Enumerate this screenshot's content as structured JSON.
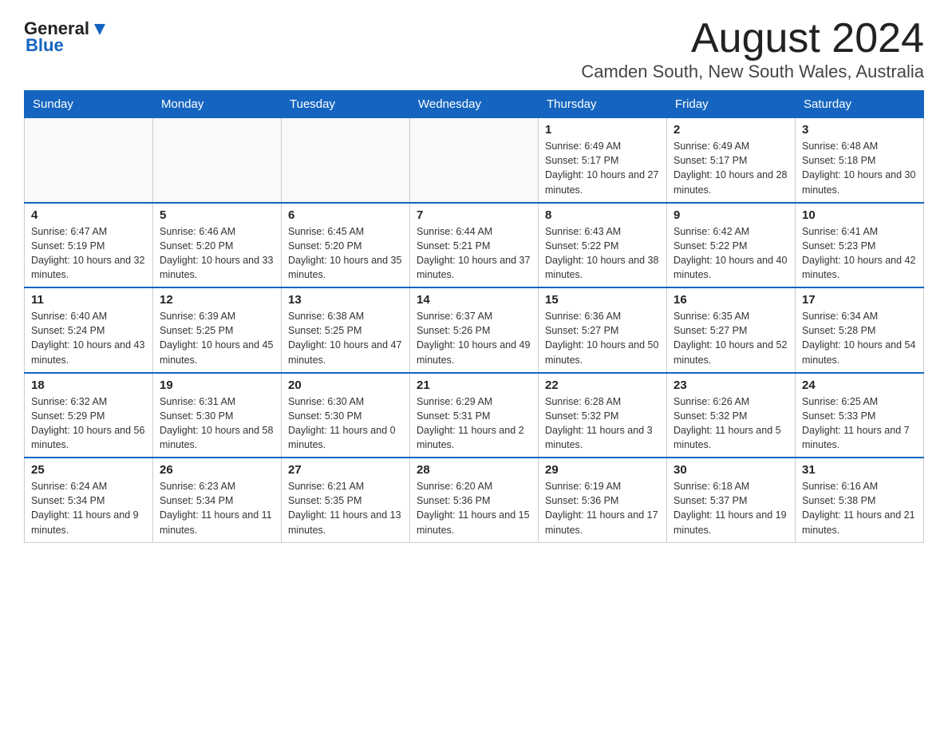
{
  "header": {
    "logo_general": "General",
    "logo_blue": "Blue",
    "month_title": "August 2024",
    "location": "Camden South, New South Wales, Australia"
  },
  "days_of_week": [
    "Sunday",
    "Monday",
    "Tuesday",
    "Wednesday",
    "Thursday",
    "Friday",
    "Saturday"
  ],
  "weeks": [
    [
      {
        "day": "",
        "info": ""
      },
      {
        "day": "",
        "info": ""
      },
      {
        "day": "",
        "info": ""
      },
      {
        "day": "",
        "info": ""
      },
      {
        "day": "1",
        "info": "Sunrise: 6:49 AM\nSunset: 5:17 PM\nDaylight: 10 hours and 27 minutes."
      },
      {
        "day": "2",
        "info": "Sunrise: 6:49 AM\nSunset: 5:17 PM\nDaylight: 10 hours and 28 minutes."
      },
      {
        "day": "3",
        "info": "Sunrise: 6:48 AM\nSunset: 5:18 PM\nDaylight: 10 hours and 30 minutes."
      }
    ],
    [
      {
        "day": "4",
        "info": "Sunrise: 6:47 AM\nSunset: 5:19 PM\nDaylight: 10 hours and 32 minutes."
      },
      {
        "day": "5",
        "info": "Sunrise: 6:46 AM\nSunset: 5:20 PM\nDaylight: 10 hours and 33 minutes."
      },
      {
        "day": "6",
        "info": "Sunrise: 6:45 AM\nSunset: 5:20 PM\nDaylight: 10 hours and 35 minutes."
      },
      {
        "day": "7",
        "info": "Sunrise: 6:44 AM\nSunset: 5:21 PM\nDaylight: 10 hours and 37 minutes."
      },
      {
        "day": "8",
        "info": "Sunrise: 6:43 AM\nSunset: 5:22 PM\nDaylight: 10 hours and 38 minutes."
      },
      {
        "day": "9",
        "info": "Sunrise: 6:42 AM\nSunset: 5:22 PM\nDaylight: 10 hours and 40 minutes."
      },
      {
        "day": "10",
        "info": "Sunrise: 6:41 AM\nSunset: 5:23 PM\nDaylight: 10 hours and 42 minutes."
      }
    ],
    [
      {
        "day": "11",
        "info": "Sunrise: 6:40 AM\nSunset: 5:24 PM\nDaylight: 10 hours and 43 minutes."
      },
      {
        "day": "12",
        "info": "Sunrise: 6:39 AM\nSunset: 5:25 PM\nDaylight: 10 hours and 45 minutes."
      },
      {
        "day": "13",
        "info": "Sunrise: 6:38 AM\nSunset: 5:25 PM\nDaylight: 10 hours and 47 minutes."
      },
      {
        "day": "14",
        "info": "Sunrise: 6:37 AM\nSunset: 5:26 PM\nDaylight: 10 hours and 49 minutes."
      },
      {
        "day": "15",
        "info": "Sunrise: 6:36 AM\nSunset: 5:27 PM\nDaylight: 10 hours and 50 minutes."
      },
      {
        "day": "16",
        "info": "Sunrise: 6:35 AM\nSunset: 5:27 PM\nDaylight: 10 hours and 52 minutes."
      },
      {
        "day": "17",
        "info": "Sunrise: 6:34 AM\nSunset: 5:28 PM\nDaylight: 10 hours and 54 minutes."
      }
    ],
    [
      {
        "day": "18",
        "info": "Sunrise: 6:32 AM\nSunset: 5:29 PM\nDaylight: 10 hours and 56 minutes."
      },
      {
        "day": "19",
        "info": "Sunrise: 6:31 AM\nSunset: 5:30 PM\nDaylight: 10 hours and 58 minutes."
      },
      {
        "day": "20",
        "info": "Sunrise: 6:30 AM\nSunset: 5:30 PM\nDaylight: 11 hours and 0 minutes."
      },
      {
        "day": "21",
        "info": "Sunrise: 6:29 AM\nSunset: 5:31 PM\nDaylight: 11 hours and 2 minutes."
      },
      {
        "day": "22",
        "info": "Sunrise: 6:28 AM\nSunset: 5:32 PM\nDaylight: 11 hours and 3 minutes."
      },
      {
        "day": "23",
        "info": "Sunrise: 6:26 AM\nSunset: 5:32 PM\nDaylight: 11 hours and 5 minutes."
      },
      {
        "day": "24",
        "info": "Sunrise: 6:25 AM\nSunset: 5:33 PM\nDaylight: 11 hours and 7 minutes."
      }
    ],
    [
      {
        "day": "25",
        "info": "Sunrise: 6:24 AM\nSunset: 5:34 PM\nDaylight: 11 hours and 9 minutes."
      },
      {
        "day": "26",
        "info": "Sunrise: 6:23 AM\nSunset: 5:34 PM\nDaylight: 11 hours and 11 minutes."
      },
      {
        "day": "27",
        "info": "Sunrise: 6:21 AM\nSunset: 5:35 PM\nDaylight: 11 hours and 13 minutes."
      },
      {
        "day": "28",
        "info": "Sunrise: 6:20 AM\nSunset: 5:36 PM\nDaylight: 11 hours and 15 minutes."
      },
      {
        "day": "29",
        "info": "Sunrise: 6:19 AM\nSunset: 5:36 PM\nDaylight: 11 hours and 17 minutes."
      },
      {
        "day": "30",
        "info": "Sunrise: 6:18 AM\nSunset: 5:37 PM\nDaylight: 11 hours and 19 minutes."
      },
      {
        "day": "31",
        "info": "Sunrise: 6:16 AM\nSunset: 5:38 PM\nDaylight: 11 hours and 21 minutes."
      }
    ]
  ]
}
